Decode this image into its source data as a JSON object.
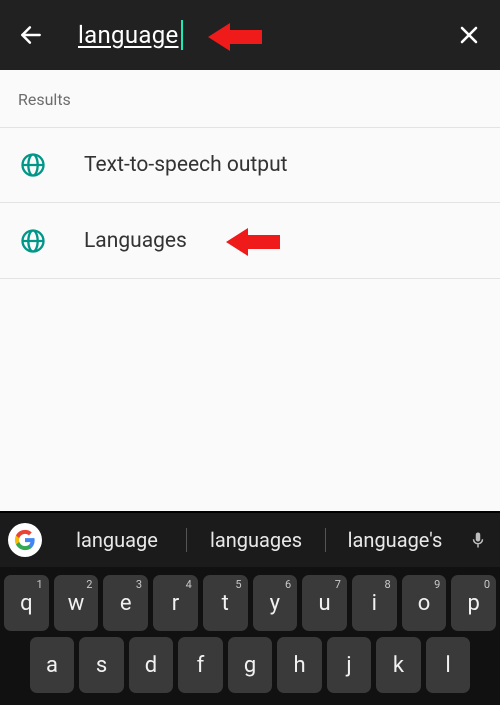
{
  "accent_teal": "#009688",
  "cursor_color": "#1de9b6",
  "search": {
    "value": "language"
  },
  "results": {
    "header": "Results",
    "items": [
      {
        "label": "Text-to-speech output",
        "icon": "globe-icon"
      },
      {
        "label": "Languages",
        "icon": "globe-icon"
      }
    ]
  },
  "keyboard": {
    "suggestions": [
      "language",
      "languages",
      "language's"
    ],
    "row1": [
      {
        "k": "q",
        "s": "1"
      },
      {
        "k": "w",
        "s": "2"
      },
      {
        "k": "e",
        "s": "3"
      },
      {
        "k": "r",
        "s": "4"
      },
      {
        "k": "t",
        "s": "5"
      },
      {
        "k": "y",
        "s": "6"
      },
      {
        "k": "u",
        "s": "7"
      },
      {
        "k": "i",
        "s": "8"
      },
      {
        "k": "o",
        "s": "9"
      },
      {
        "k": "p",
        "s": "0"
      }
    ],
    "row2": [
      {
        "k": "a"
      },
      {
        "k": "s"
      },
      {
        "k": "d"
      },
      {
        "k": "f"
      },
      {
        "k": "g"
      },
      {
        "k": "h"
      },
      {
        "k": "j"
      },
      {
        "k": "k"
      },
      {
        "k": "l"
      }
    ]
  }
}
